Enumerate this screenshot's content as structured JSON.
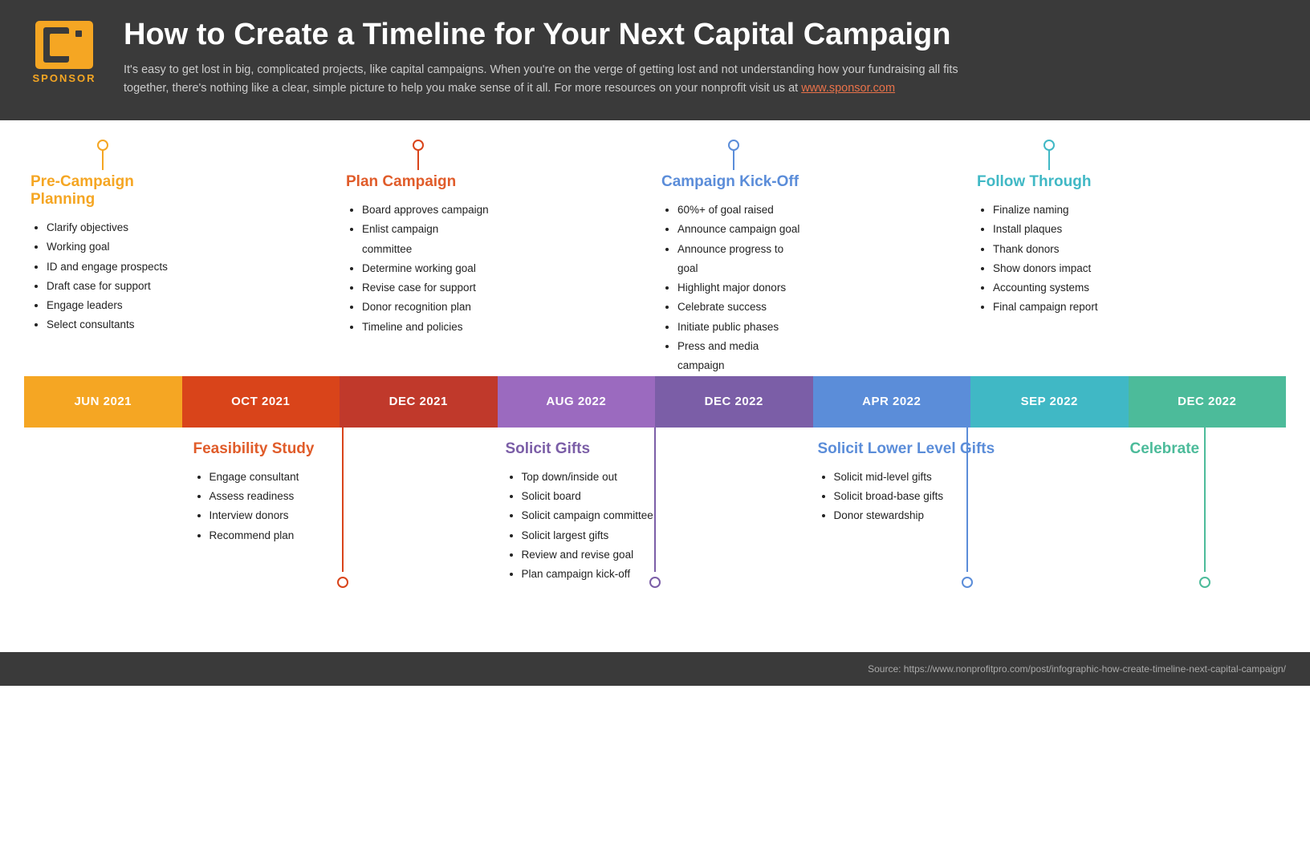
{
  "header": {
    "logo_text": "SPONSOR",
    "title": "How to Create a Timeline for Your Next Capital Campaign",
    "description": "It's easy to get lost in big, complicated projects, like capital campaigns. When you're on the verge of getting lost and not understanding how your fundraising all fits together, there's nothing like a clear, simple picture to help you make sense of it all. For more resources on your nonprofit visit us at",
    "link_text": "www.sponsor.com",
    "link_url": "http://www.sponsor.com"
  },
  "top_phases": [
    {
      "id": "pre-campaign",
      "title": "Pre-Campaign Planning",
      "color": "orange",
      "items": [
        "Clarify objectives",
        "Working goal",
        "ID and engage prospects",
        "Draft case for support",
        "Engage leaders",
        "Select consultants"
      ]
    },
    {
      "id": "plan-campaign",
      "title": "Plan Campaign",
      "color": "red-orange",
      "items": [
        "Board approves campaign",
        "Enlist campaign committee",
        "Determine working goal",
        "Revise case for support",
        "Donor recognition plan",
        "Timeline and policies"
      ]
    },
    {
      "id": "campaign-kickoff",
      "title": "Campaign Kick-Off",
      "color": "blue",
      "items": [
        "60%+ of goal raised",
        "Announce campaign goal",
        "Announce progress to goal",
        "Highlight major donors",
        "Celebrate success",
        "Initiate public phases",
        "Press and media campaign"
      ]
    },
    {
      "id": "follow-through",
      "title": "Follow Through",
      "color": "teal",
      "items": [
        "Finalize naming",
        "Install plaques",
        "Thank donors",
        "Show donors impact",
        "Accounting systems",
        "Final campaign report"
      ]
    }
  ],
  "timeline_blocks": [
    {
      "label": "JUN 2021",
      "bg": "orange"
    },
    {
      "label": "OCT 2021",
      "bg": "red-orange"
    },
    {
      "label": "DEC 2021",
      "bg": "dark-red"
    },
    {
      "label": "AUG 2022",
      "bg": "purple-light"
    },
    {
      "label": "DEC 2022",
      "bg": "purple"
    },
    {
      "label": "APR 2022",
      "bg": "blue"
    },
    {
      "label": "SEP 2022",
      "bg": "teal"
    },
    {
      "label": "DEC 2022",
      "bg": "green"
    }
  ],
  "bottom_phases": [
    {
      "id": "feasibility-study",
      "title": "Feasibility Study",
      "color": "red-orange",
      "col_span": 2,
      "items": [
        "Engage consultant",
        "Assess readiness",
        "Interview donors",
        "Recommend plan"
      ]
    },
    {
      "id": "solicit-gifts",
      "title": "Solicit Gifts",
      "color": "purple",
      "col_span": 2,
      "items": [
        "Top down/inside out",
        "Solicit board",
        "Solicit campaign committee",
        "Solicit largest gifts",
        "Review and revise goal",
        "Plan campaign kick-off"
      ]
    },
    {
      "id": "solicit-lower-level",
      "title": "Solicit Lower Level Gifts",
      "color": "blue",
      "col_span": 2,
      "items": [
        "Solicit mid-level gifts",
        "Solicit broad-base gifts",
        "Donor stewardship"
      ]
    },
    {
      "id": "celebrate",
      "title": "Celebrate",
      "color": "green",
      "col_span": 1,
      "items": []
    }
  ],
  "footer": {
    "source": "Source: https://www.nonprofitpro.com/post/infographic-how-create-timeline-next-capital-campaign/"
  }
}
